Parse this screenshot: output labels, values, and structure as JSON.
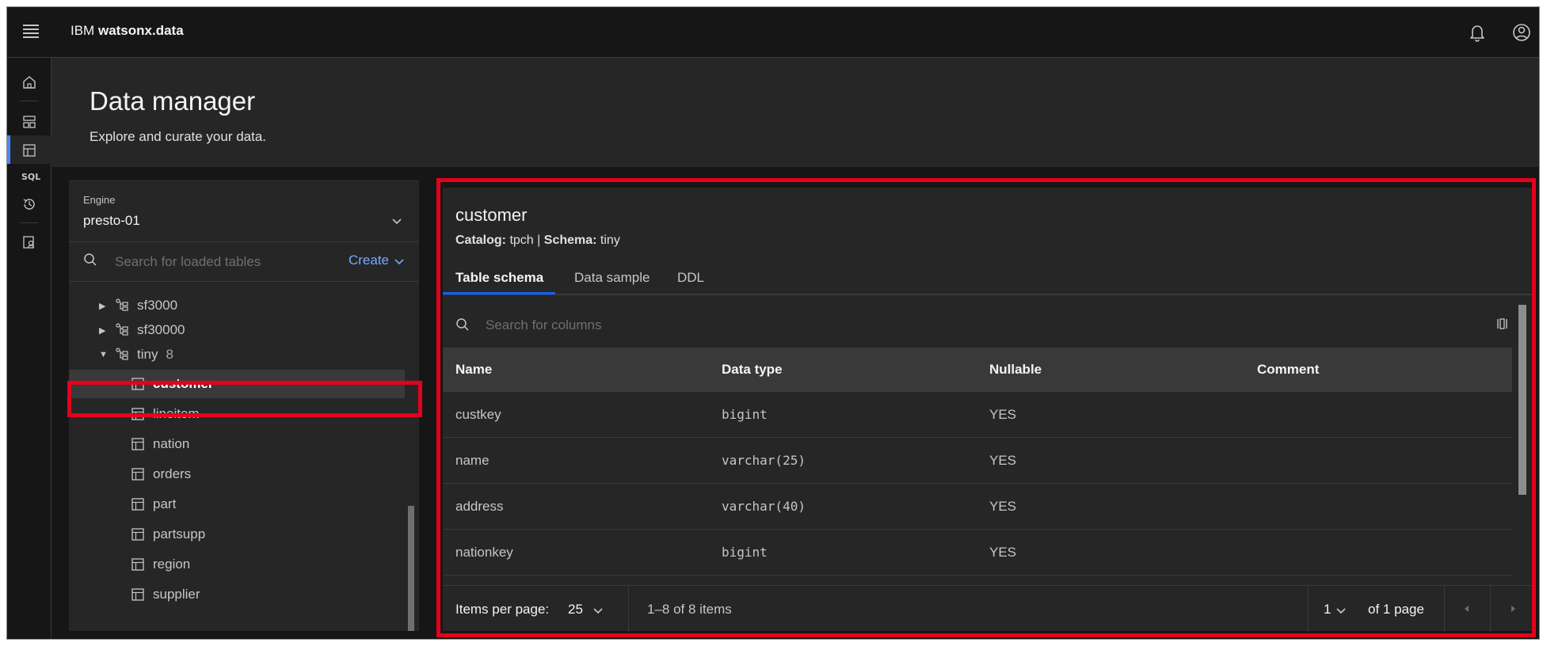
{
  "header": {
    "brand_prefix": "IBM",
    "brand_product": "watsonx.data",
    "icons": [
      "menu-icon",
      "notification-icon",
      "user-avatar-icon"
    ]
  },
  "rail": {
    "items": [
      "home-icon",
      "infrastructure-icon",
      "data-manager-icon",
      "SQL",
      "query-history-icon",
      "access-control-icon"
    ],
    "sql_label": "SQL",
    "active": "data-manager-icon"
  },
  "page": {
    "title": "Data manager",
    "subtitle": "Explore and curate your data."
  },
  "left_panel": {
    "engine_label": "Engine",
    "engine_value": "presto-01",
    "search_placeholder": "Search for loaded tables",
    "create_label": "Create",
    "schemas": [
      {
        "name": "sf3000",
        "expanded": false
      },
      {
        "name": "sf30000",
        "expanded": false
      },
      {
        "name": "tiny",
        "count": "8",
        "expanded": true
      }
    ],
    "tables": [
      "customer",
      "lineitem",
      "nation",
      "orders",
      "part",
      "partsupp",
      "region",
      "supplier"
    ],
    "selected_table": "customer"
  },
  "detail": {
    "title": "customer",
    "catalog_label": "Catalog:",
    "catalog_value": "tpch",
    "separator": "|",
    "schema_label": "Schema:",
    "schema_value": "tiny",
    "tabs": [
      "Table schema",
      "Data sample",
      "DDL"
    ],
    "active_tab": "Table schema",
    "search_placeholder": "Search for columns",
    "columns": [
      "Name",
      "Data type",
      "Nullable",
      "Comment"
    ],
    "rows": [
      {
        "name": "custkey",
        "type": "bigint",
        "nullable": "YES",
        "comment": ""
      },
      {
        "name": "name",
        "type": "varchar(25)",
        "nullable": "YES",
        "comment": ""
      },
      {
        "name": "address",
        "type": "varchar(40)",
        "nullable": "YES",
        "comment": ""
      },
      {
        "name": "nationkey",
        "type": "bigint",
        "nullable": "YES",
        "comment": ""
      }
    ],
    "pagination": {
      "items_per_page_label": "Items per page:",
      "items_per_page": "25",
      "range": "1–8 of 8 items",
      "page": "1",
      "of_pages": "of 1 page"
    }
  },
  "colors": {
    "background": "#161616",
    "panel": "#262626",
    "accent": "#0f62fe",
    "link": "#78a9ff",
    "highlight": "#e5001d"
  }
}
